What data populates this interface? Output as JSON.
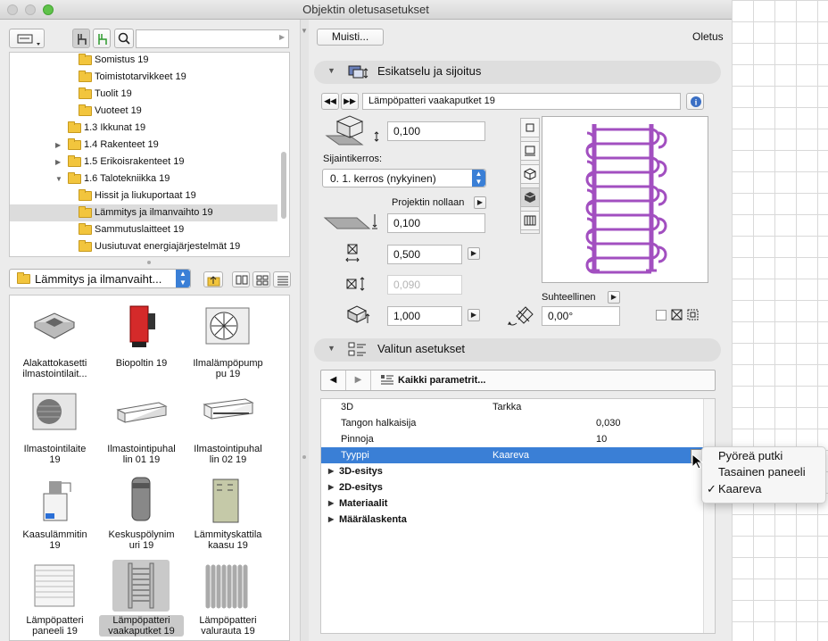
{
  "window": {
    "title": "Objektin oletusasetukset"
  },
  "left": {
    "search_placeholder": "",
    "tree": [
      {
        "label": "Somistus 19",
        "indent": 2
      },
      {
        "label": "Toimistotarvikkeet 19",
        "indent": 2
      },
      {
        "label": "Tuolit 19",
        "indent": 2
      },
      {
        "label": "Vuoteet 19",
        "indent": 2
      },
      {
        "label": "1.3 Ikkunat 19",
        "indent": 1
      },
      {
        "label": "1.4 Rakenteet 19",
        "indent": 1
      },
      {
        "label": "1.5 Erikoisrakenteet 19",
        "indent": 1
      },
      {
        "label": "1.6 Talotekniikka 19",
        "indent": 1
      },
      {
        "label": "Hissit ja liukuportaat 19",
        "indent": 2
      },
      {
        "label": "Lämmitys ja ilmanvaihto 19",
        "indent": 2
      },
      {
        "label": "Sammutuslaitteet 19",
        "indent": 2
      },
      {
        "label": "Uusiutuvat energiajärjestelmät 19",
        "indent": 2
      }
    ],
    "folder_select": "Lämmitys ja ilmanvaiht...",
    "library_items": [
      {
        "line1": "Alakattokasetti",
        "line2": "ilmastointilait..."
      },
      {
        "line1": "Biopoltin 19",
        "line2": ""
      },
      {
        "line1": "Ilmalämpöpump",
        "line2": "pu 19"
      },
      {
        "line1": "Ilmastointilaite",
        "line2": "19"
      },
      {
        "line1": "Ilmastointipuhal",
        "line2": "lin 01 19"
      },
      {
        "line1": "Ilmastointipuhal",
        "line2": "lin 02 19"
      },
      {
        "line1": "Kaasulämmitin",
        "line2": "19"
      },
      {
        "line1": "Keskuspölynim",
        "line2": "uri 19"
      },
      {
        "line1": "Lämmityskattila",
        "line2": "kaasu 19"
      },
      {
        "line1": "Lämpöpatteri",
        "line2": "paneeli 19"
      },
      {
        "line1": "Lämpöpatteri",
        "line2": "vaakaputket 19"
      },
      {
        "line1": "Lämpöpatteri",
        "line2": "valurauta 19"
      }
    ]
  },
  "right": {
    "memory_button": "Muisti...",
    "default_label": "Oletus",
    "preview_section": "Esikatselu ja sijoitus",
    "object_name": "Lämpöpatteri vaakaputket 19",
    "elevation_value": "0,100",
    "home_story_label": "Sijaintikerros:",
    "home_story_value": "0. 1. kerros (nykyinen)",
    "project_zero_label": "Projektin nollaan",
    "project_zero_value": "0,100",
    "width_value": "0,500",
    "depth_value": "0,090",
    "height_value": "1,000",
    "relative_label": "Suhteellinen",
    "angle_value": "0,00°",
    "selected_section": "Valitun asetukset",
    "params_dropdown": "Kaikki parametrit...",
    "params_header": {
      "col1": "3D",
      "col2": "Tarkka"
    },
    "params": [
      {
        "name": "Tangon halkaisija",
        "type": "",
        "value": "0,030"
      },
      {
        "name": "Pinnoja",
        "type": "",
        "value": "10"
      },
      {
        "name": "Tyyppi",
        "type": "Kaareva",
        "value": ""
      }
    ],
    "groups": [
      "3D-esitys",
      "2D-esitys",
      "Materiaalit",
      "Määrälaskenta"
    ],
    "popup": {
      "options": [
        "Pyöreä putki",
        "Tasainen paneeli",
        "Kaareva"
      ],
      "checkmark": "✓"
    }
  },
  "colors": {
    "selection": "#3a7fd6",
    "preview_stroke": "#a24fc0",
    "folder": "#f2c53d"
  }
}
